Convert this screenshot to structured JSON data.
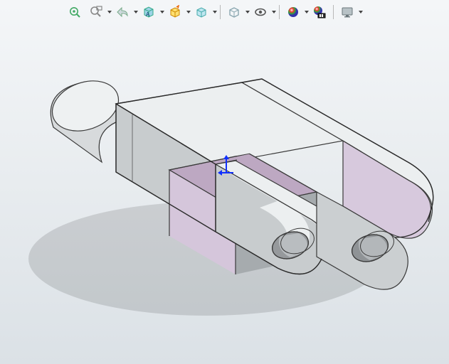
{
  "toolbar": {
    "items": [
      {
        "name": "zoom-to-fit-icon"
      },
      {
        "name": "zoom-window-icon"
      },
      {
        "name": "previous-view-icon"
      },
      {
        "name": "section-view-icon"
      },
      {
        "name": "orientation-icon"
      },
      {
        "name": "display-style-icon"
      },
      {
        "name": "hide-show-icon"
      },
      {
        "name": "visibility-icon"
      },
      {
        "name": "appearance-icon"
      },
      {
        "name": "scene-icon"
      },
      {
        "name": "viewport-icon"
      }
    ]
  },
  "viewport": {
    "model": "yoke-clevis-part",
    "origin_visible": true
  }
}
